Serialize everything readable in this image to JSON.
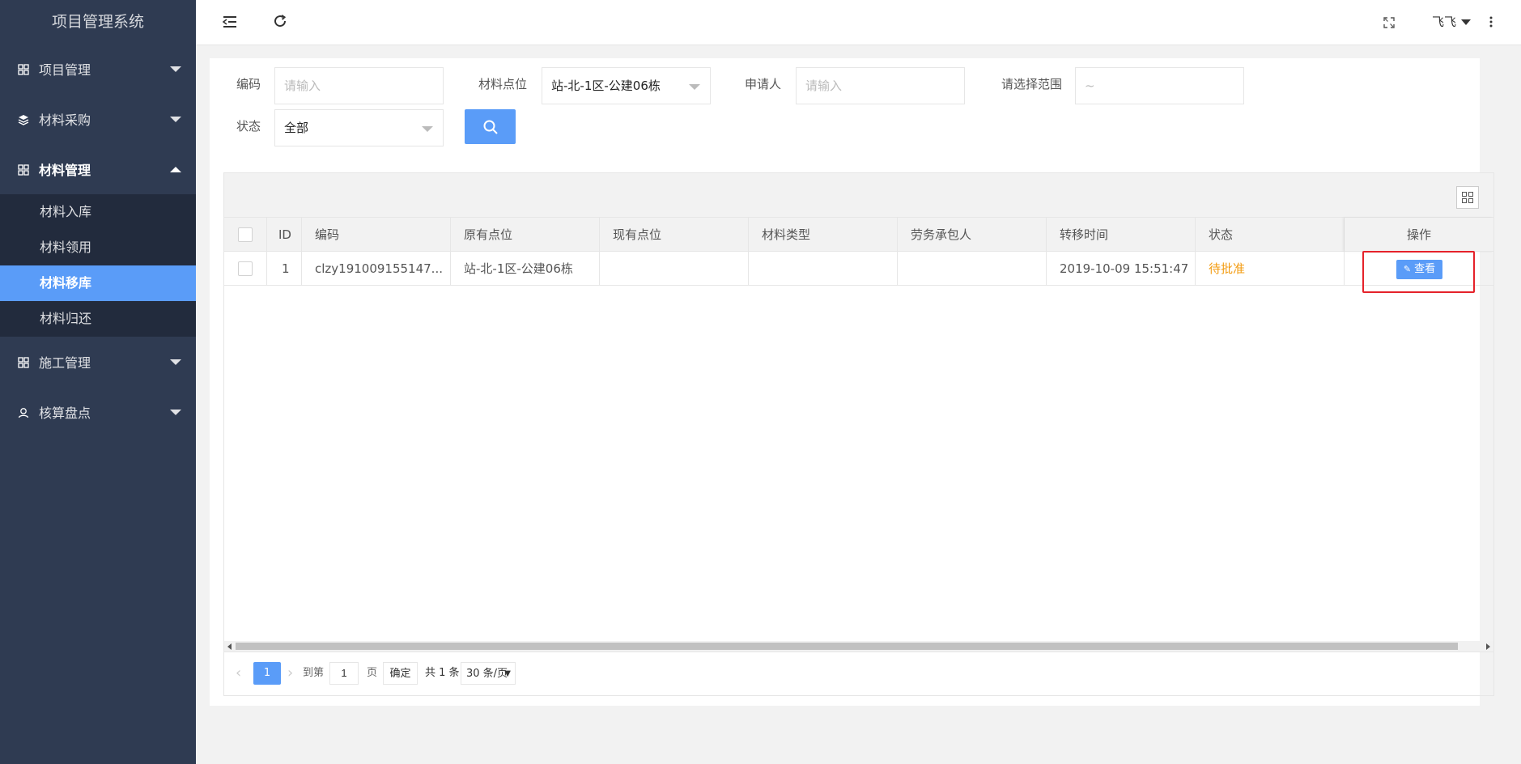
{
  "app": {
    "title": "项目管理系统"
  },
  "sidebar": {
    "groups": [
      {
        "label": "项目管理"
      },
      {
        "label": "材料采购"
      },
      {
        "label": "材料管理",
        "items": [
          "材料入库",
          "材料领用",
          "材料移库",
          "材料归还"
        ],
        "active": "材料移库"
      },
      {
        "label": "施工管理"
      },
      {
        "label": "核算盘点"
      }
    ]
  },
  "header": {
    "user": "飞飞",
    "icons": [
      "menu-fold-icon",
      "refresh-icon",
      "fullscreen-icon",
      "more-vertical-icon"
    ]
  },
  "filters": {
    "code_label": "编码",
    "code_placeholder": "请输入",
    "location_label": "材料点位",
    "location_value": "站-北-1区-公建06栋",
    "applicant_label": "申请人",
    "applicant_placeholder": "请输入",
    "range_label": "请选择范围",
    "range_placeholder": "~",
    "status_label": "状态",
    "status_value": "全部"
  },
  "table": {
    "headers": [
      "ID",
      "编码",
      "原有点位",
      "现有点位",
      "材料类型",
      "劳务承包人",
      "转移时间",
      "状态",
      "操作"
    ],
    "rows": [
      {
        "id": "1",
        "code": "clzy191009155147...",
        "from": "站-北-1区-公建06栋",
        "to": "",
        "type": "",
        "contractor": "",
        "time": "2019-10-09 15:51:47",
        "status": "待批准",
        "action": "查看"
      }
    ]
  },
  "pager": {
    "current": "1",
    "goto_label": "到第",
    "goto_value": "1",
    "page_unit": "页",
    "confirm": "确定",
    "total": "共 1 条",
    "page_size": "30 条/页"
  },
  "colors": {
    "sidebar": "#2f3b52",
    "accent": "#5a9cf8",
    "pending": "#f39c12",
    "highlight": "#e5222a"
  }
}
